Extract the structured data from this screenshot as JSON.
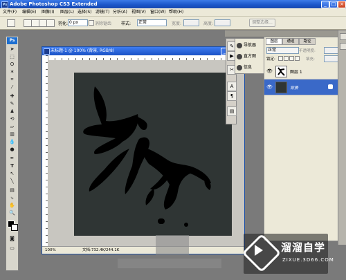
{
  "window": {
    "title": "Adobe Photoshop CS3 Extended",
    "app_icon": "Ps"
  },
  "menubar": {
    "items": [
      "文件(F)",
      "编辑(E)",
      "图像(I)",
      "图层(L)",
      "选择(S)",
      "滤镜(T)",
      "分析(A)",
      "视图(V)",
      "窗口(W)",
      "帮助(H)"
    ]
  },
  "options_bar": {
    "feather_label": "羽化:",
    "feather_value": "0 px",
    "antialias_label": "消除锯齿",
    "style_label": "样式:",
    "style_value": "正常",
    "width_label": "宽度:",
    "height_label": "高度:",
    "refine_edge_label": "调整边缘..."
  },
  "toolbox": {
    "logo": "Ps"
  },
  "document": {
    "title": "未标题-1 @ 100% (背景, RGB/8)",
    "zoom": "100%",
    "doc_info": "文档:732.4K/244.1K"
  },
  "navigator_panel": {
    "items": [
      "导航器",
      "直方图",
      "信息"
    ]
  },
  "layers_panel": {
    "tabs": [
      "图层",
      "通道",
      "路径"
    ],
    "blend_mode": "正常",
    "opacity_label": "不透明度:",
    "lock_label": "锁定:",
    "fill_label": "填充:",
    "layers": [
      {
        "name": "图层 1",
        "selected": false
      },
      {
        "name": "背景",
        "selected": true
      }
    ]
  },
  "watermark": {
    "brand": "溜溜自学",
    "site": "ZIXUE.3D66.COM"
  },
  "colors": {
    "canvas_bg": "#2f3534",
    "ink": "#000000",
    "selection": "#3a69c8"
  }
}
